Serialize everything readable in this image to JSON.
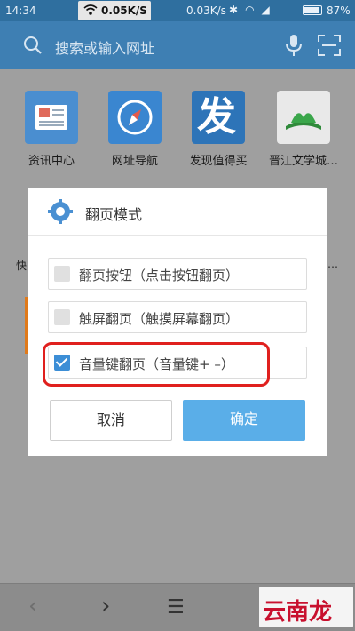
{
  "status": {
    "time": "14:34",
    "speed_chip": "0.05K/S",
    "right_speed": "0.03K/s",
    "battery": "87%",
    "battery_level": 0.87
  },
  "search": {
    "placeholder": "搜索或输入网址"
  },
  "tiles": [
    {
      "label": "资讯中心",
      "icon": "news-icon",
      "color": "#4a8ed0"
    },
    {
      "label": "网址导航",
      "icon": "compass-icon",
      "color": "#3a86d0"
    },
    {
      "label": "发现值得买",
      "icon": "fa-logo-icon",
      "color": "#2d74b8",
      "glyph": "发"
    },
    {
      "label": "晋江文学城…",
      "icon": "book-icon",
      "color": "#e9e9e9"
    }
  ],
  "side_left": "快",
  "side_right": "…",
  "dialog": {
    "title": "翻页模式",
    "options": [
      {
        "label": "翻页按钮（点击按钮翻页）",
        "checked": false
      },
      {
        "label": "触屏翻页（触摸屏幕翻页）",
        "checked": false
      },
      {
        "label": "音量键翻页（音量键+ –）",
        "checked": true
      }
    ],
    "cancel": "取消",
    "confirm": "确定"
  },
  "watermark": "云南龙网",
  "colors": {
    "accent": "#3e7fb3",
    "highlight": "#e0201e",
    "confirm": "#5aaee8"
  }
}
